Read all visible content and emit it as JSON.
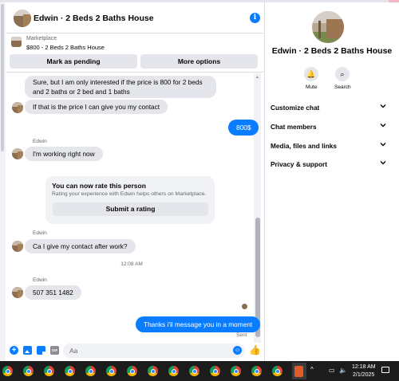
{
  "header": {
    "title": "Edwin · 2 Beds 2 Baths House",
    "info_icon": "info-icon",
    "info_glyph": "i"
  },
  "marketplace": {
    "label": "Marketplace",
    "listing": "$800 - 2 Beds 2 Baths House",
    "buttons": {
      "pending": "Mark as pending",
      "more": "More options"
    }
  },
  "messages": {
    "m1": "Sure, but I am only interested if the price is 800 for 2 beds and 2 baths or 2 bed and 1 baths",
    "m2": "If that is the price I can give you my contact",
    "m3": "800$",
    "name1": "Edwin",
    "m4": "I'm working right now",
    "rate": {
      "title": "You can now rate this person",
      "subtitle": "Rating your experience with Edwin helps others on Marketplace.",
      "button": "Submit a rating"
    },
    "name2": "Edwin",
    "m5": "Ca I give my contact after work?",
    "timestamp": "12:08 AM",
    "name3": "Edwin",
    "m6": "507 351 1482",
    "m7": "Thanks i'il message you in a moment",
    "sent": "Sent"
  },
  "composer": {
    "placeholder": "Aa",
    "icons": [
      "plus-icon",
      "image-icon",
      "sticker-icon",
      "gif-icon",
      "emoji-icon",
      "like-icon"
    ],
    "plus_glyph": "+",
    "gif_glyph": "GIF",
    "emoji_glyph": "☺",
    "like_glyph": "👍"
  },
  "panel": {
    "title": "Edwin · 2 Beds 2 Baths House",
    "mute": "Mute",
    "search": "Search",
    "mute_glyph": "🔔",
    "search_glyph": "⌕",
    "rows": [
      "Customize chat",
      "Chat members",
      "Media, files and links",
      "Privacy & support"
    ]
  },
  "taskbar": {
    "time": "12:18 AM",
    "date": "2/1/2025",
    "tray_chevron": "^",
    "tray_icons": [
      "▭",
      "🔈"
    ]
  },
  "colors": {
    "accent": "#0a7cff",
    "bubble_in": "#e4e6eb",
    "taskbar": "#1c1c1c"
  }
}
